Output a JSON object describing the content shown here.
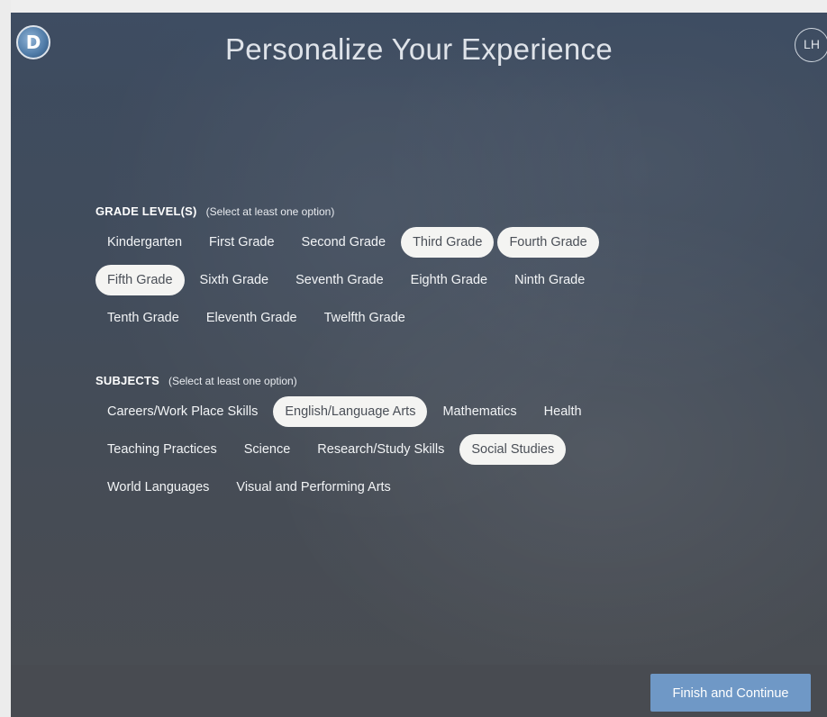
{
  "header": {
    "logo_letter": "D",
    "logo_icon": "discovery-education-globe-icon",
    "title": "Personalize Your Experience",
    "avatar_initials": "LH"
  },
  "grade_section": {
    "heading": "GRADE LEVEL(S)",
    "hint": "(Select at least one option)",
    "rows": [
      [
        {
          "label": "Kindergarten",
          "selected": false
        },
        {
          "label": "First Grade",
          "selected": false
        },
        {
          "label": "Second Grade",
          "selected": false
        },
        {
          "label": "Third Grade",
          "selected": true
        },
        {
          "label": "Fourth Grade",
          "selected": true
        }
      ],
      [
        {
          "label": "Fifth Grade",
          "selected": true
        },
        {
          "label": "Sixth Grade",
          "selected": false
        },
        {
          "label": "Seventh Grade",
          "selected": false
        },
        {
          "label": "Eighth Grade",
          "selected": false
        },
        {
          "label": "Ninth Grade",
          "selected": false
        }
      ],
      [
        {
          "label": "Tenth Grade",
          "selected": false
        },
        {
          "label": "Eleventh Grade",
          "selected": false
        },
        {
          "label": "Twelfth Grade",
          "selected": false
        }
      ]
    ]
  },
  "subject_section": {
    "heading": "SUBJECTS",
    "hint": "(Select at least one option)",
    "rows": [
      [
        {
          "label": "Careers/Work Place Skills",
          "selected": false
        },
        {
          "label": "English/Language Arts",
          "selected": true
        },
        {
          "label": "Mathematics",
          "selected": false
        },
        {
          "label": "Health",
          "selected": false
        }
      ],
      [
        {
          "label": "Teaching Practices",
          "selected": false
        },
        {
          "label": "Science",
          "selected": false
        },
        {
          "label": "Research/Study Skills",
          "selected": false
        },
        {
          "label": "Social Studies",
          "selected": true
        }
      ],
      [
        {
          "label": "World Languages",
          "selected": false
        },
        {
          "label": "Visual and Performing Arts",
          "selected": false
        }
      ]
    ]
  },
  "footer": {
    "finish_label": "Finish and Continue"
  },
  "colors": {
    "selected_chip_bg": "#f4f4f2",
    "selected_chip_text": "#4a4f57",
    "button_bg": "#6f98c6",
    "page_bg": "#414c5c"
  }
}
